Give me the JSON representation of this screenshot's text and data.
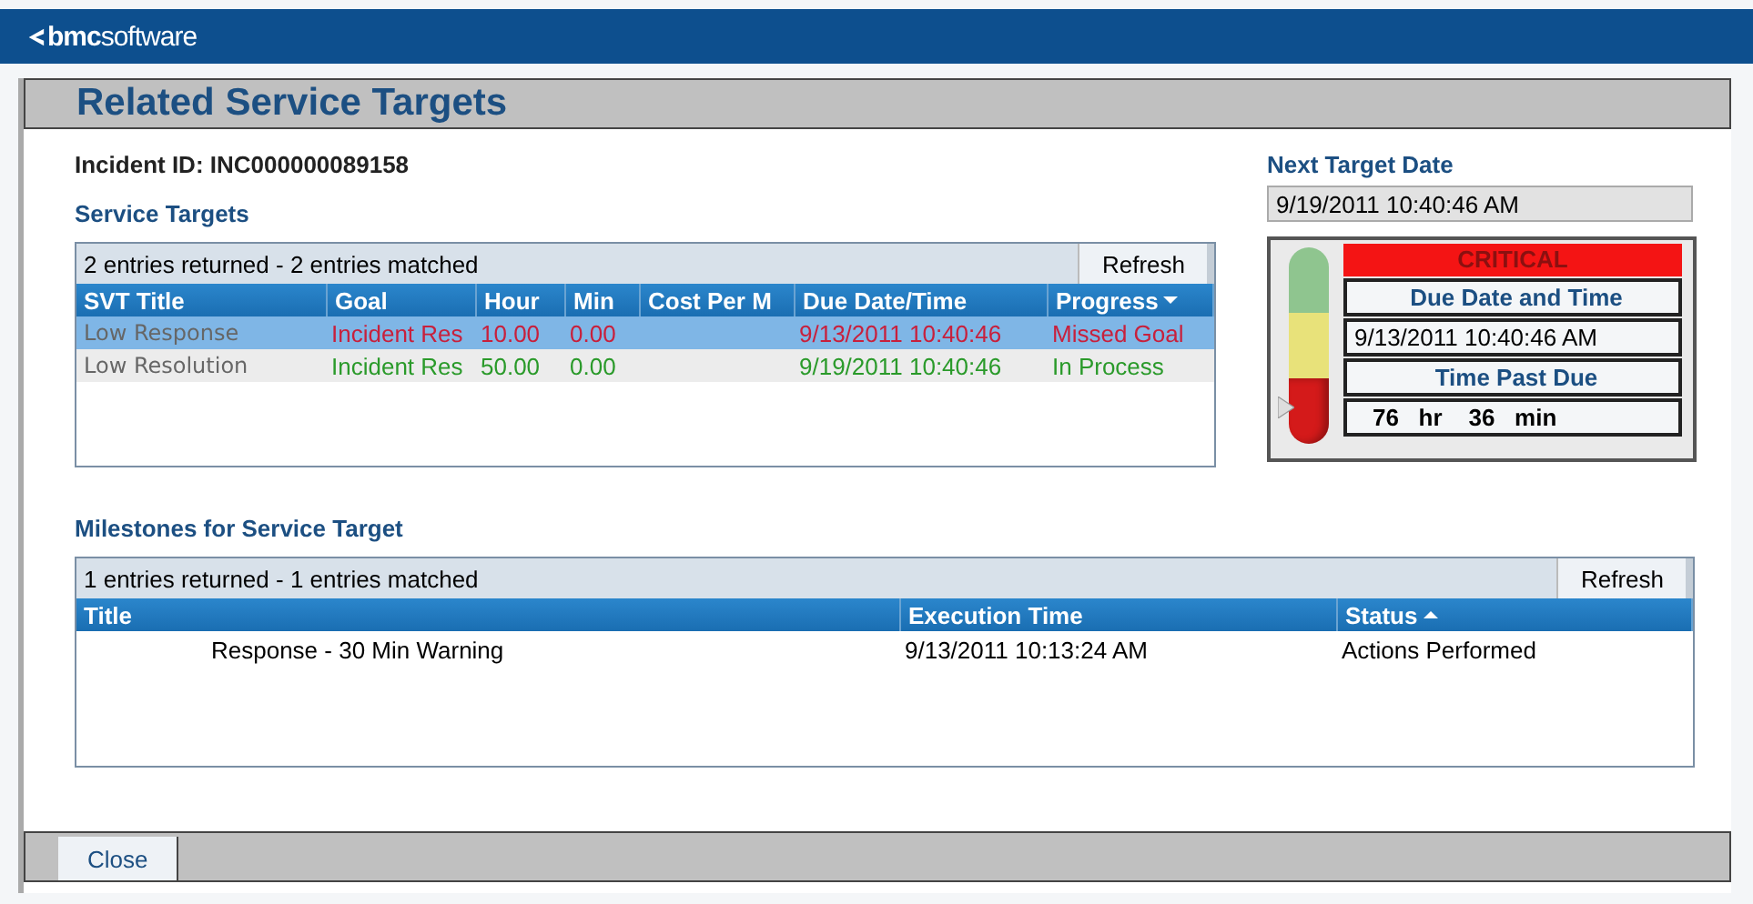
{
  "logo": "**bmc**software",
  "title": "Related Service Targets",
  "incident_id": "Incident ID: INC000000089158",
  "service_targets": {
    "heading": "Service Targets",
    "summary": "2 entries returned - 2 entries matched",
    "refresh": "Refresh",
    "columns": [
      {
        "label": "SVT Title",
        "sorted": false
      },
      {
        "label": "Goal",
        "sorted": false
      },
      {
        "label": "Hour",
        "sorted": false
      },
      {
        "label": "Min",
        "sorted": false
      },
      {
        "label": "Cost Per M",
        "sorted": false
      },
      {
        "label": "Due Date/Time",
        "sorted": false
      },
      {
        "label": "Progress",
        "sorted": true,
        "ascending": false
      }
    ],
    "rows": [
      {
        "selected": true,
        "color": "#c8203c",
        "cells": [
          "Low Response",
          "Incident Res",
          "10.00",
          "0.00",
          "",
          "9/13/2011 10:40:46",
          "Missed Goal"
        ]
      },
      {
        "selected": false,
        "color": "#2a9a2a",
        "cells": [
          "Low Resolution",
          "Incident Res",
          "50.00",
          "0.00",
          "",
          "9/19/2011 10:40:46",
          "In Process"
        ]
      }
    ]
  },
  "next_target": {
    "label": "Next Target Date",
    "value": "9/19/2011 10:40:46 AM"
  },
  "status_panel": {
    "severity": "CRITICAL",
    "due_label": "Due Date and Time",
    "due_value": "9/13/2011 10:40:46 AM",
    "past_label": "Time Past Due",
    "past_value": "76   hr    36   min",
    "lights": [
      {
        "color": "#8fc58f",
        "on": false
      },
      {
        "color": "#e8e27a",
        "on": false
      },
      {
        "color": "#d41a1a",
        "on": true
      }
    ]
  },
  "milestones": {
    "heading": "Milestones for Service Target",
    "summary": "1 entries returned - 1 entries matched",
    "refresh": "Refresh",
    "columns": [
      {
        "label": "Title",
        "sorted": false
      },
      {
        "label": "Execution Time",
        "sorted": false
      },
      {
        "label": "Status",
        "sorted": true,
        "ascending": true
      }
    ],
    "rows": [
      {
        "selected": false,
        "cells": [
          "Response - 30 Min Warning",
          "9/13/2011 10:13:24 AM",
          "Actions Performed"
        ]
      }
    ]
  },
  "close": "Close"
}
